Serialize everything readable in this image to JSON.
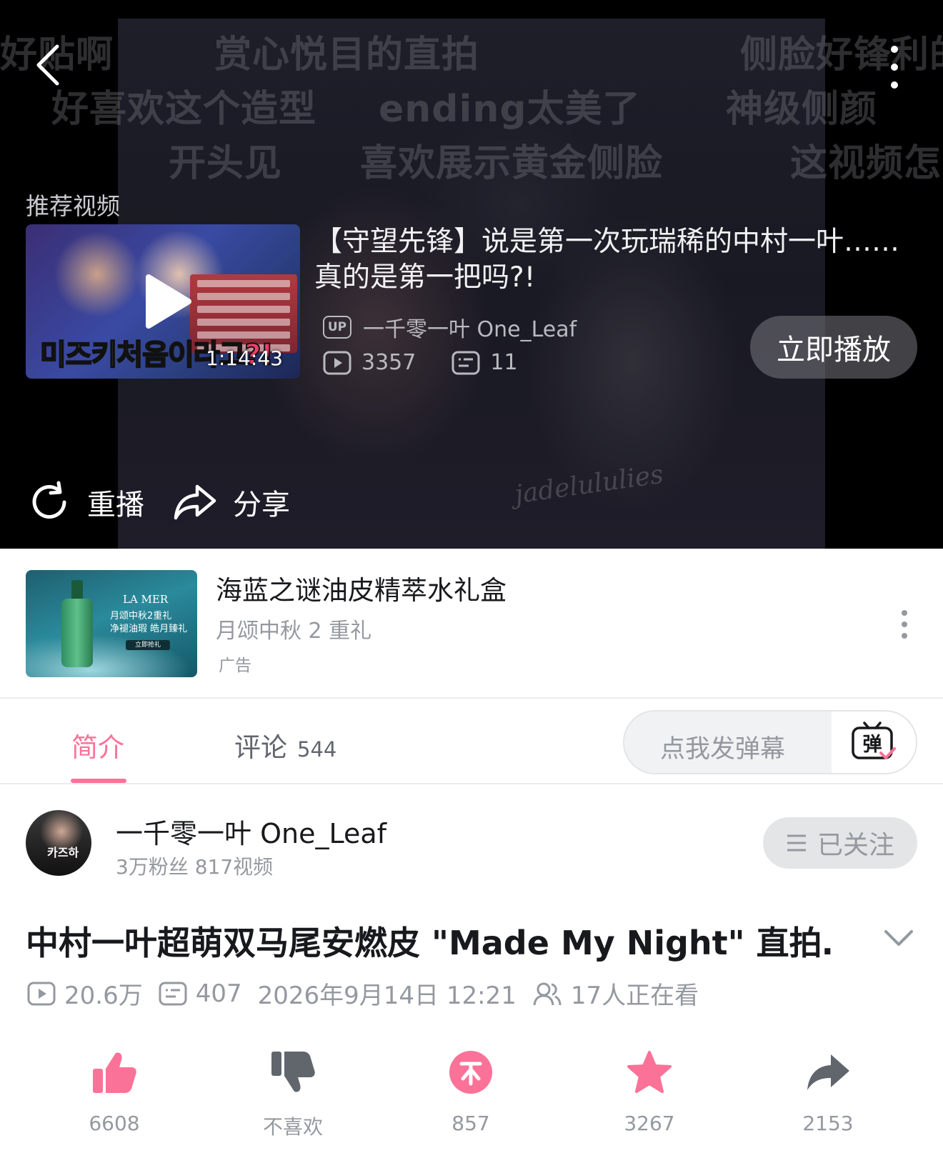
{
  "player": {
    "danmaku": [
      "好贴啊",
      "赏心悦目的直拍",
      "侧脸好锋利的",
      "好喜欢这个造型",
      "ending太美了",
      "神级侧颜",
      "开头见",
      "喜欢展示黄金侧脸",
      "这视频怎么"
    ],
    "watermark": "jadelululies",
    "recommend_label": "推荐视频",
    "recommended": {
      "thumb_text_a": "미즈키",
      "thumb_text_b": "처음이라고?!",
      "duration": "1:14:43",
      "title": "【守望先锋】说是第一次玩瑞稀的中村一叶……真的是第一把吗?!",
      "up_badge": "UP",
      "uploader": "一千零一叶 One_Leaf",
      "views": "3357",
      "danmaku_count": "11",
      "play_now_label": "立即播放"
    },
    "replay_label": "重播",
    "share_label": "分享"
  },
  "ad": {
    "brand": "LA MER",
    "thumb_sub_1": "月颂中秋2重礼",
    "thumb_sub_2": "净褪油瑕 皓月臻礼",
    "thumb_cta": "立即抢礼",
    "title": "海蓝之谜油皮精萃水礼盒",
    "subtitle": "月颂中秋 2 重礼",
    "label": "广告"
  },
  "tabs": {
    "intro_label": "简介",
    "comment_label": "评论",
    "comment_count": "544",
    "danmaku_placeholder": "点我发弹幕",
    "danmaku_icon_char": "弹",
    "accent_color": "#fb7299"
  },
  "uploader": {
    "name": "一千零一叶 One_Leaf",
    "meta": "3万粉丝   817视频",
    "avatar_text": "카즈하",
    "follow_label": "已关注"
  },
  "video": {
    "title": "中村一叶超萌双马尾安燃皮 \"Made My Night\" 直拍…",
    "views": "20.6万",
    "danmaku": "407",
    "date": "2026年9月14日 12:21",
    "watching": "17人正在看"
  },
  "actions": {
    "like": "6608",
    "dislike": "不喜欢",
    "coin": "857",
    "favorite": "3267",
    "share": "2153"
  }
}
